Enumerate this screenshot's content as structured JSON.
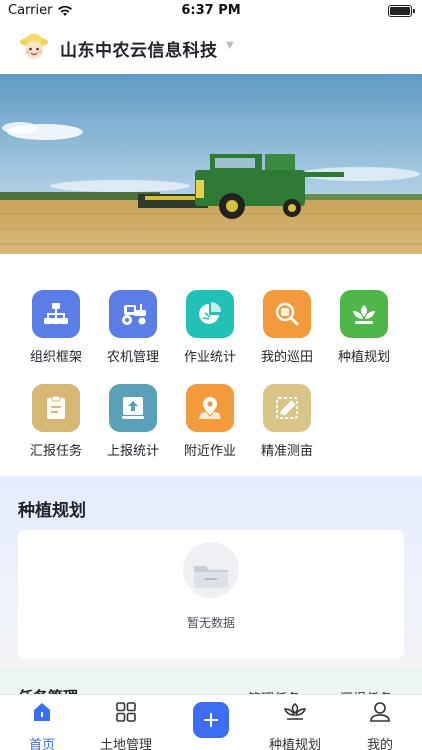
{
  "status_bar": {
    "carrier": "Carrier",
    "time": "6:37 PM"
  },
  "header": {
    "company": "山东中农云信息科技"
  },
  "grid": [
    {
      "label": "组织框架",
      "icon": "org-chart-icon",
      "color": "#5b7de8"
    },
    {
      "label": "农机管理",
      "icon": "tractor-icon",
      "color": "#5b7de8"
    },
    {
      "label": "作业统计",
      "icon": "pie-chart-icon",
      "color": "#21c1b7"
    },
    {
      "label": "我的巡田",
      "icon": "search-field-icon",
      "color": "#f39b3c"
    },
    {
      "label": "种植规划",
      "icon": "sprout-icon",
      "color": "#4fb64a"
    },
    {
      "label": "汇报任务",
      "icon": "clipboard-icon",
      "color": "#d6b874"
    },
    {
      "label": "上报统计",
      "icon": "upload-icon",
      "color": "#5aa0b8"
    },
    {
      "label": "附近作业",
      "icon": "location-pin-icon",
      "color": "#f39b3c"
    },
    {
      "label": "精准测亩",
      "icon": "ruler-icon",
      "color": "#d9c48a"
    }
  ],
  "planting": {
    "title": "种植规划",
    "empty_text": "暂无数据"
  },
  "tasks": {
    "title": "任务管理",
    "tab1": "管理任务",
    "tab2": "汇报任务"
  },
  "tabbar": [
    {
      "label": "首页",
      "icon": "home-icon",
      "active": true
    },
    {
      "label": "土地管理",
      "icon": "grid-icon",
      "active": false
    },
    {
      "label": "",
      "icon": "plus-icon",
      "active": false
    },
    {
      "label": "种植规划",
      "icon": "plant-icon",
      "active": false
    },
    {
      "label": "我的",
      "icon": "user-icon",
      "active": false
    }
  ],
  "colors": {
    "accent": "#3b6ef5"
  }
}
